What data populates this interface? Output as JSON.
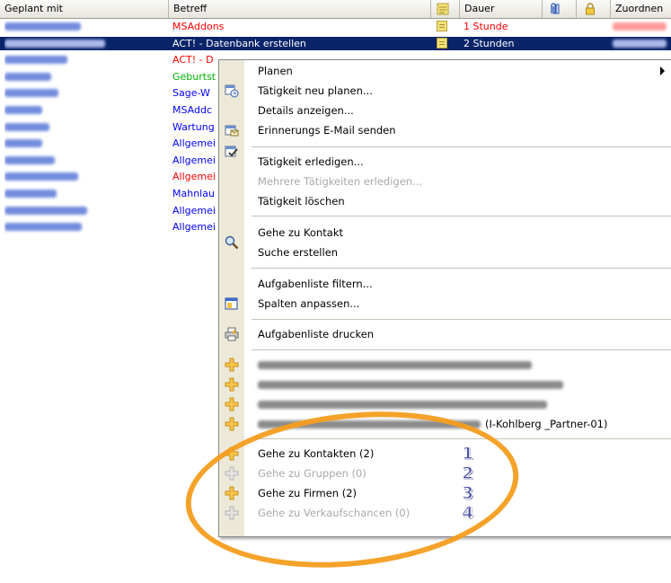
{
  "grid": {
    "columns": {
      "geplant_mit": "Geplant mit",
      "betreff": "Betreff",
      "dauer": "Dauer",
      "zuordnen": "Zuordnen"
    },
    "rows": [
      {
        "betreff": "MSAddons",
        "betreff_color": "#ff0000",
        "dauer": "1 Stunde",
        "selected": false
      },
      {
        "betreff": "ACT! - Datenbank erstellen",
        "betreff_color": "#ffffff",
        "dauer": "2 Stunden",
        "selected": true
      },
      {
        "betreff": "ACT! - D",
        "betreff_color": "#ff0000",
        "dauer": "",
        "selected": false
      },
      {
        "betreff": "Geburtst",
        "betreff_color": "#00b400",
        "dauer": "",
        "selected": false
      },
      {
        "betreff": "Sage-W",
        "betreff_color": "#0000ff",
        "dauer": "",
        "selected": false
      },
      {
        "betreff": "MSAddc",
        "betreff_color": "#0000ff",
        "dauer": "",
        "selected": false
      },
      {
        "betreff": "Wartung",
        "betreff_color": "#0000ff",
        "dauer": "",
        "selected": false
      },
      {
        "betreff": "Allgemei",
        "betreff_color": "#0000ff",
        "dauer": "",
        "selected": false
      },
      {
        "betreff": "Allgemei",
        "betreff_color": "#0000ff",
        "dauer": "",
        "selected": false
      },
      {
        "betreff": "Allgemei",
        "betreff_color": "#ff0000",
        "dauer": "",
        "selected": false
      },
      {
        "betreff": "Mahnlau",
        "betreff_color": "#0000ff",
        "dauer": "",
        "selected": false
      },
      {
        "betreff": "Allgemei",
        "betreff_color": "#0000ff",
        "dauer": "",
        "selected": false
      },
      {
        "betreff": "Allgemei",
        "betreff_color": "#0000ff",
        "dauer": "",
        "selected": false
      }
    ]
  },
  "context_menu": {
    "planen": "Planen",
    "taetigkeit_neu_planen": "Tätigkeit neu planen...",
    "details_anzeigen": "Details anzeigen...",
    "erinnerungs_email": "Erinnerungs E-Mail senden",
    "taetigkeit_erledigen": "Tätigkeit erledigen...",
    "mehrere_erledigen": "Mehrere Tätigkeiten erledigen...",
    "taetigkeit_loeschen": "Tätigkeit löschen",
    "gehe_zu_kontakt": "Gehe zu Kontakt",
    "suche_erstellen": "Suche erstellen",
    "aufgabenliste_filtern": "Aufgabenliste filtern...",
    "spalten_anpassen": "Spalten anpassen...",
    "aufgabenliste_drucken": "Aufgabenliste drucken",
    "gehe_zu_kontakten": "Gehe zu Kontakten (2)",
    "gehe_zu_gruppen": "Gehe zu Gruppen (0)",
    "gehe_zu_firmen": "Gehe zu Firmen (2)",
    "gehe_zu_verkaufschancen": "Gehe zu Verkaufschancen (0)",
    "verkaufschance_partial": "(I-Kohlberg _Partner-01)"
  },
  "annotations": {
    "n1": "1",
    "n2": "2",
    "n3": "3",
    "n4": "4",
    "highlight_color": "#f49d1f"
  }
}
